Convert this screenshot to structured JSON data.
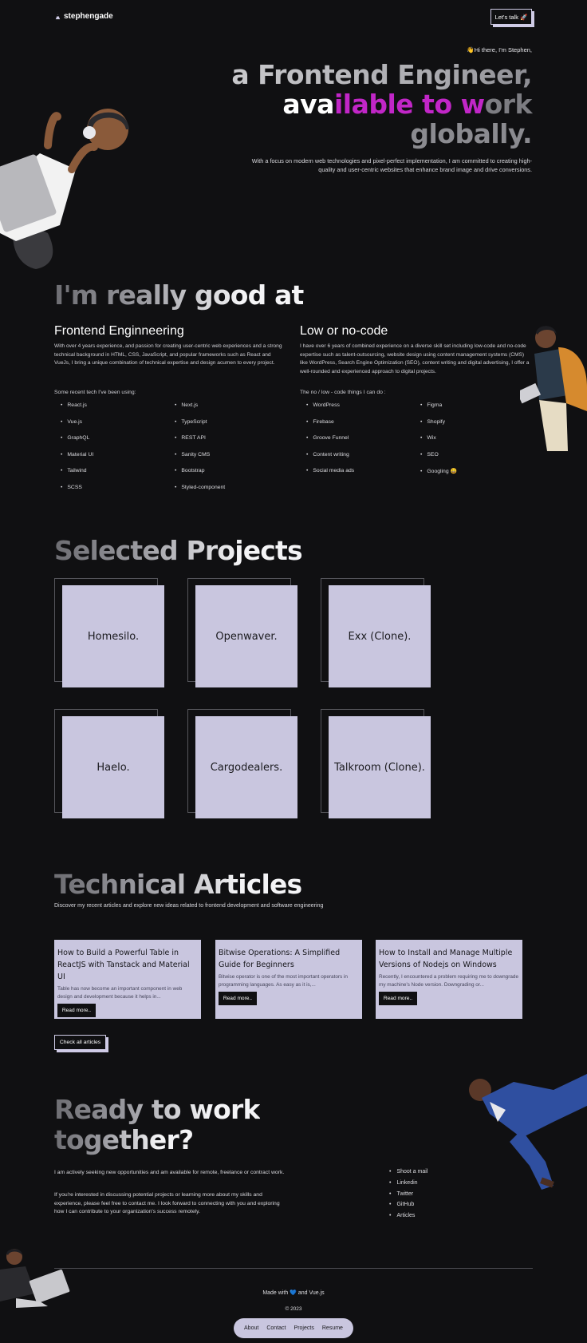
{
  "header": {
    "logo_text": "stephengade",
    "cta_label": "Let's talk 🚀"
  },
  "hero": {
    "greeting": "👋Hi there, I'm Stephen,",
    "line1": "a Frontend Engineer,",
    "line2_white": "ava",
    "line2_purple": "ilable to w",
    "line2_gray": "ork",
    "line3": "globally.",
    "description": "With a focus on modern web technologies and pixel-perfect implementation, I am committed to creating high-quality and user-centric websites that enhance brand image and drive conversions."
  },
  "skills": {
    "heading": "I'm really good at",
    "frontend": {
      "title": "Frontend Enginneering",
      "description": "With over 4 years experience, and passion for creating user-centric web experiences and a strong technical background in HTML, CSS, JavaScript, and popular frameworks such as React and VueJs, I bring a unique combination of technical expertise and design acumen to every project.",
      "intro": "Some recent tech I've been using:",
      "col1": [
        "React.js",
        "Vue.js",
        "GraphQL",
        "Material UI",
        "Tailwind",
        "SCSS"
      ],
      "col2": [
        "Next.js",
        "TypeScript",
        "REST API",
        "Sanity CMS",
        "Bootstrap",
        "Styled-component"
      ]
    },
    "nocode": {
      "title": "Low or no-code",
      "description": "I have over 6 years of combined experience on a diverse skill set including low-code and no-code expertise such as talent-outsourcing, website design using content management systems (CMS) like WordPress, Search Engine Optimization (SEO), content writing and digital advertising, I offer a well-rounded and experienced approach to digital projects.",
      "intro": "The no / low - code things I can do :",
      "col1": [
        "WordPress",
        "Firebase",
        "Groove Funnel",
        "Content writing",
        "Social media ads"
      ],
      "col2": [
        "Figma",
        "Shopify",
        "Wix",
        "SEO",
        "Googling 😄"
      ]
    }
  },
  "projects": {
    "heading": "Selected Projects",
    "items": [
      "Homesilo.",
      "Openwaver.",
      "Exx (Clone).",
      "Haelo.",
      "Cargodealers.",
      "Talkroom (Clone)."
    ]
  },
  "articles": {
    "heading": "Technical Articles",
    "subtitle": "Discover my recent articles and explore new ideas related to frontend development and software engineering",
    "items": [
      {
        "title": "How to Build a Powerful Table in ReactJS with Tanstack and Material UI",
        "excerpt": "Table has now become an important component in web design and development because it helps in...",
        "button": "Read more.."
      },
      {
        "title": "Bitwise Operations: A Simplified Guide for Beginners",
        "excerpt": "Bitwise operator is one of the most important operators in programming languages. As easy as it is,...",
        "button": "Read more.."
      },
      {
        "title": "How to Install and Manage Multiple Versions of Nodejs on Windows",
        "excerpt": "Recently, I encountered a problem requiring me to downgrade my machine's Node version. Downgrading or...",
        "button": "Read more.."
      }
    ],
    "check_all": "Check all articles"
  },
  "contact": {
    "heading_line1": "Ready to work",
    "heading_line2": "together?",
    "p1": "I am actively seeking new opportunities and am available for remote, freelance or contract work.",
    "p2": "If you're interested in discussing potential projects or learning more about my skills and experience, please feel free to contact me. I look forward to connecting with you and exploring how I can contribute to your organization's success remotely.",
    "links": [
      "Shoot a mail",
      "Linkedin",
      "Twitter",
      "GitHub",
      "Articles"
    ]
  },
  "footer": {
    "made_prefix": "Made with",
    "heart": "💙",
    "made_suffix": "and Vue.js",
    "copyright": "© 2023",
    "nav": [
      "About",
      "Contact",
      "Projects",
      "Resume"
    ]
  }
}
